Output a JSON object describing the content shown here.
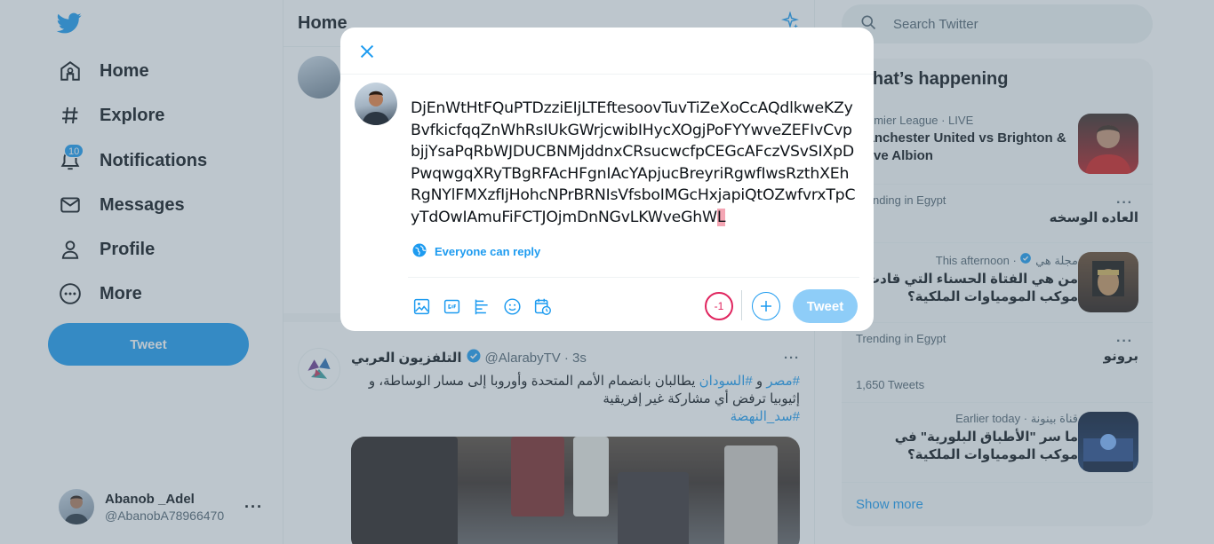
{
  "nav": {
    "items": [
      {
        "label": "Home",
        "icon": "home-icon"
      },
      {
        "label": "Explore",
        "icon": "hashtag-icon"
      },
      {
        "label": "Notifications",
        "icon": "bell-icon",
        "badge": "10"
      },
      {
        "label": "Messages",
        "icon": "envelope-icon"
      },
      {
        "label": "Profile",
        "icon": "person-icon"
      },
      {
        "label": "More",
        "icon": "more-circle-icon"
      }
    ],
    "tweet_label": "Tweet"
  },
  "account": {
    "display_name": "Abanob _Adel",
    "handle": "@AbanobA78966470",
    "more": "···"
  },
  "timeline": {
    "title": "Home",
    "tweet": {
      "name": "التلفزيون العربي",
      "handle": "@AlarabyTV",
      "time": "· 3s",
      "more": "···",
      "line1_tag1": "#مصر",
      "line1_and": " و ",
      "line1_tag2": "#السودان",
      "line1_rest": " يطالبان بانضمام الأمم المتحدة وأوروبا إلى مسار الوساطة، و",
      "line2": "إثيوبيا ترفض أي مشاركة غير إفريقية",
      "line3_tag": "#سد_النهضة"
    }
  },
  "search": {
    "placeholder": "Search Twitter"
  },
  "happening": {
    "title": "What’s happening",
    "trends": [
      {
        "meta": "Premier League · LIVE",
        "title": "Manchester United vs Brighton & Hove Albion"
      },
      {
        "meta": "Trending in Egypt",
        "title": "العاده الوسخه",
        "more": "···"
      },
      {
        "meta_name": "مجلة هي",
        "meta_time": "· This afternoon",
        "title": "من هي الفتاة الحسناء التي قادت موكب المومياوات الملكية؟"
      },
      {
        "meta": "Trending in Egypt",
        "title": "برونو",
        "count": "1,650 Tweets",
        "more": "···"
      },
      {
        "meta_name": "قناة بينونة",
        "meta_time": "· Earlier today",
        "title": "ما سر \"الأطباق البلورية\" في موكب المومياوات الملكية؟"
      }
    ],
    "show_more": "Show more"
  },
  "compose": {
    "text": "DjEnWtHtFQuPTDzziEIjLTEftesoovTuvTiZeXoCcAQdlkweKZyBvfkicfqqZnWhRsIUkGWrjcwibIHycXOgjPoFYYwveZEFIvCvpbjjYsaPqRbWJDUCBNMjddnxCRsucwcfpCEGcAFczVSvSIXpDPwqwgqXRyTBgRFAcHFgnIAcYApjucBreyriRgwfIwsRzthXEhRgNYlFMXzfIjHohcNPrBRNIsVfsboIMGcHxjapiQtOZwfvrxTpCyTdOwIAmuFiFCTJOjmDnNGvLKWveGhW",
    "caret_char": "L",
    "reply_setting": "Everyone can reply",
    "counter": "-1",
    "tweet_label": "Tweet",
    "tools": [
      "image-icon",
      "gif-icon",
      "poll-icon",
      "emoji-icon",
      "schedule-icon"
    ]
  }
}
